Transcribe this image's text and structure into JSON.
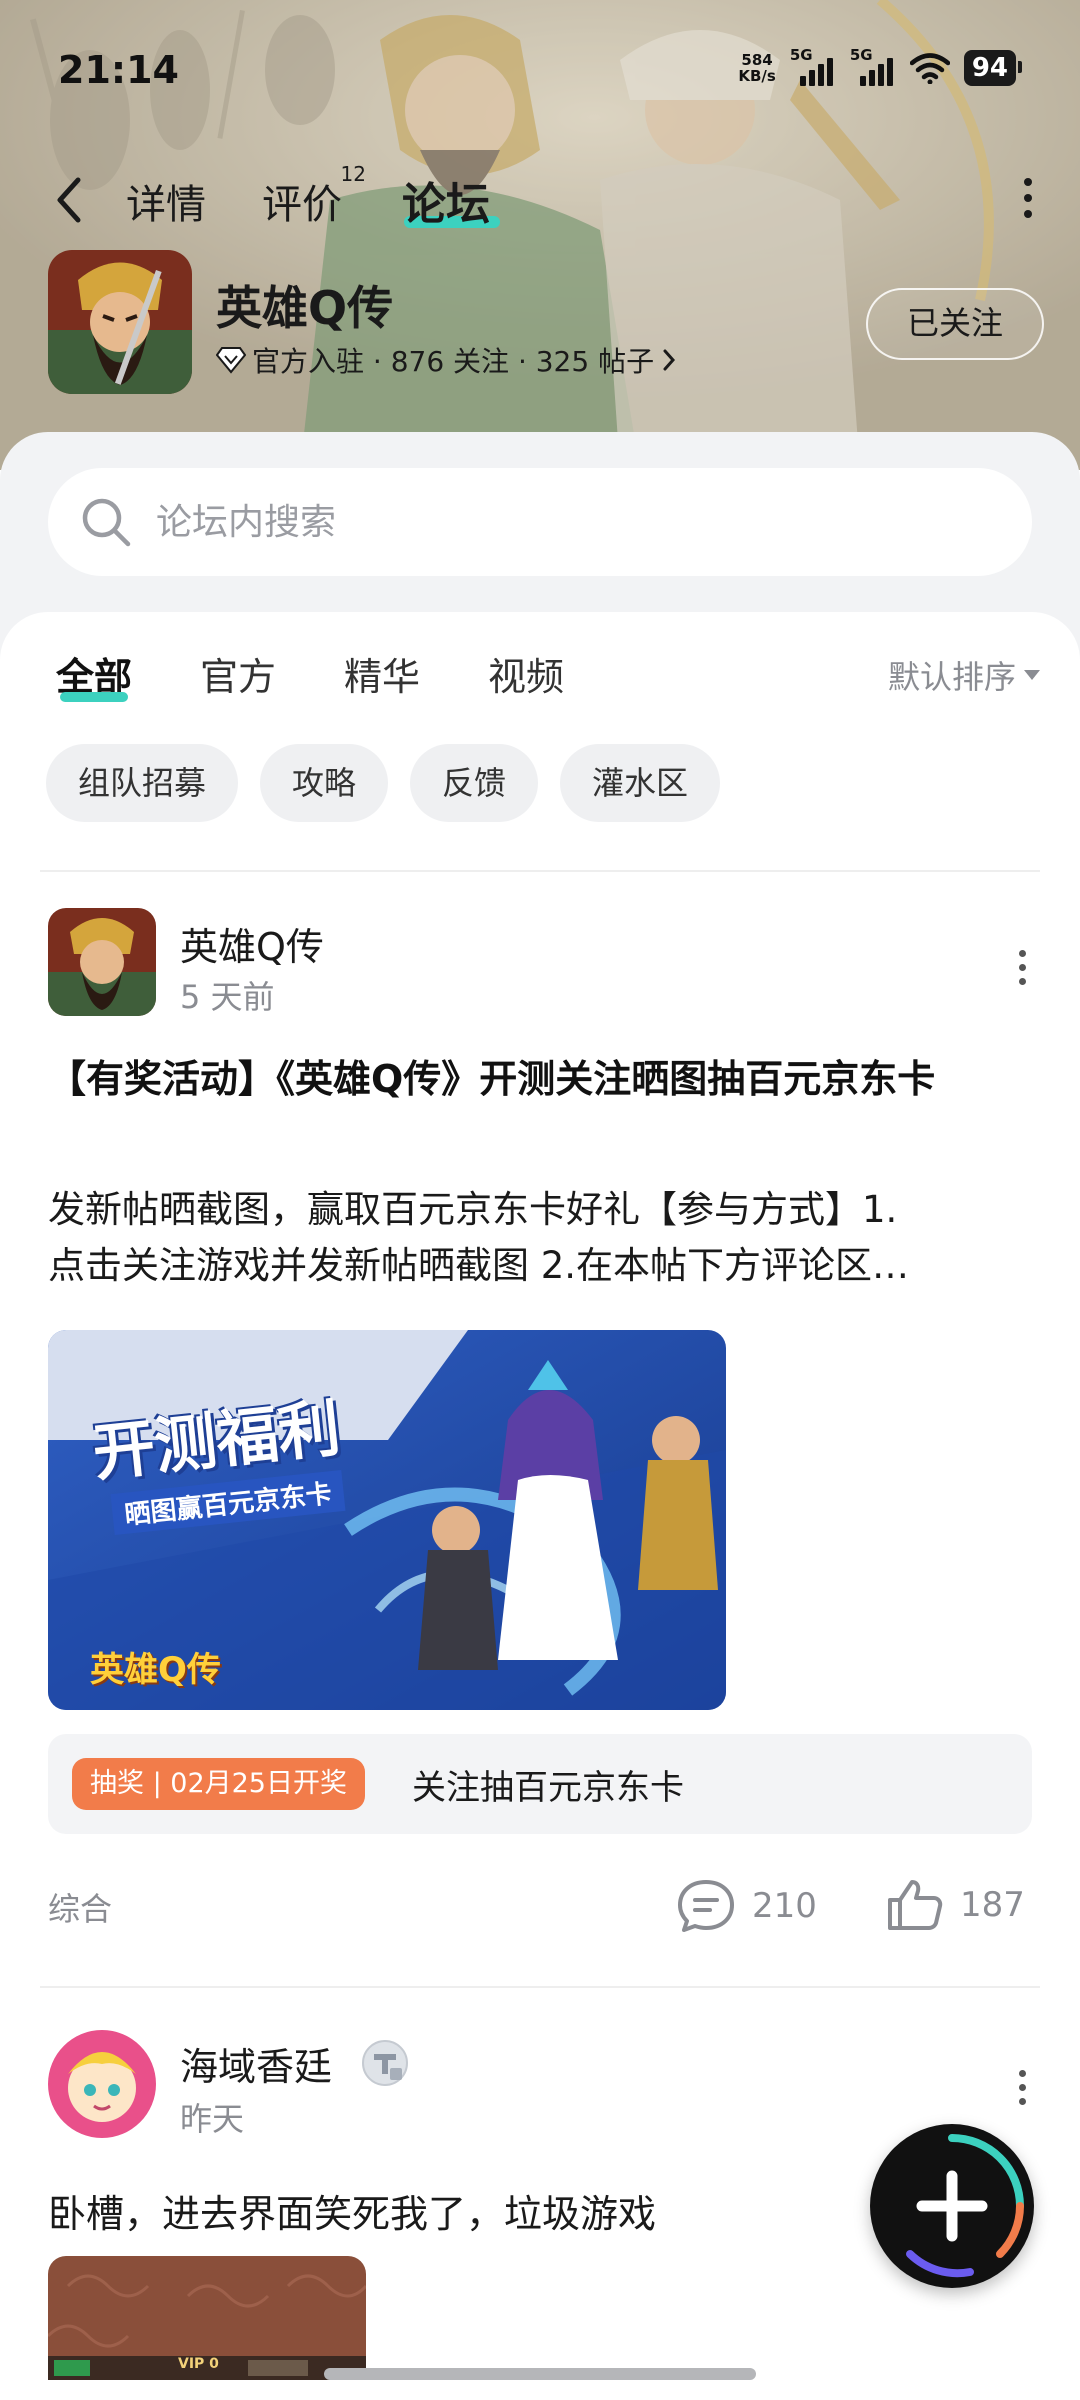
{
  "status_bar": {
    "time": "21:14",
    "net_speed_value": "584",
    "net_speed_unit": "KB/s",
    "sim1_label": "5G",
    "sim2_label": "5G",
    "battery": "94"
  },
  "nav": {
    "tabs": [
      {
        "label": "详情"
      },
      {
        "label": "评价",
        "count": "12"
      },
      {
        "label": "论坛"
      }
    ],
    "active_tab": "论坛"
  },
  "game": {
    "name": "英雄Q传",
    "meta": "官方入驻 · 876 关注 · 325 帖子",
    "follow_label": "已关注"
  },
  "search": {
    "placeholder": "论坛内搜索"
  },
  "filter_tabs": {
    "items": [
      {
        "label": "全部"
      },
      {
        "label": "官方"
      },
      {
        "label": "精华"
      },
      {
        "label": "视频"
      }
    ],
    "active": "全部",
    "sort_label": "默认排序"
  },
  "chips": [
    "组队招募",
    "攻略",
    "反馈",
    "灌水区"
  ],
  "posts": [
    {
      "author": "英雄Q传",
      "time": "5 天前",
      "title": "【有奖活动】《英雄Q传》开测关注晒图抽百元京东卡",
      "body_line1": "发新帖晒截图，赢取百元京东卡好礼【参与方式】1.",
      "body_line2": "点击关注游戏并发新帖晒截图 2.在本帖下方评论区…",
      "image_text_main": "开测福利",
      "image_text_sub": "晒图赢百元京东卡",
      "image_logo": "英雄Q传",
      "lottery_tag": "抽奖 | 02月25日开奖",
      "lottery_text": "关注抽百元京东卡",
      "category": "综合",
      "comments": "210",
      "likes": "187"
    },
    {
      "author": "海域香廷",
      "time": "昨天",
      "body": "卧槽，进去界面笑死我了，垃圾游戏",
      "thumb_vip": "VIP 0"
    }
  ],
  "colors": {
    "accent": "#3cd1bf",
    "lottery": "#f27c4a",
    "muted": "#8a8c92"
  }
}
